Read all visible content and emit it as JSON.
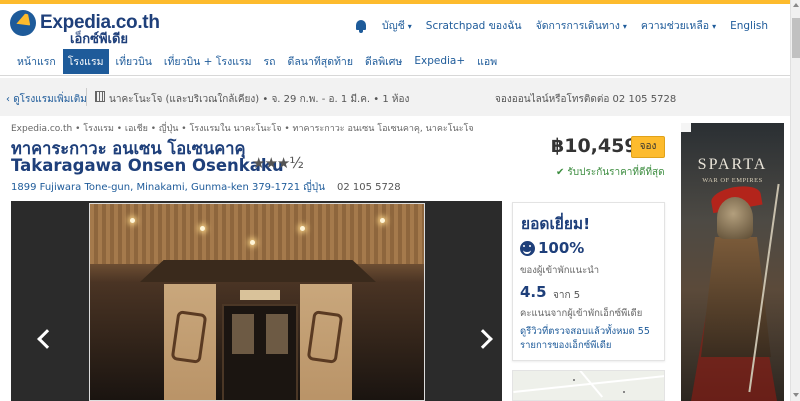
{
  "brand": {
    "name": "Expedia.co.th",
    "sub": "เอ็กซ์พีเดีย"
  },
  "top_links": {
    "account": "บัญชี",
    "scratchpad": "Scratchpad ของฉัน",
    "trips": "จัดการการเดินทาง",
    "help": "ความช่วยเหลือ",
    "language": "English"
  },
  "nav": [
    {
      "label": "หน้าแรก",
      "active": false
    },
    {
      "label": "โรงแรม",
      "active": true
    },
    {
      "label": "เที่ยวบิน",
      "active": false
    },
    {
      "label": "เที่ยวบิน + โรงแรม",
      "active": false
    },
    {
      "label": "รถ",
      "active": false
    },
    {
      "label": "ดีลนาทีสุดท้าย",
      "active": false
    },
    {
      "label": "ดีลพิเศษ",
      "active": false
    },
    {
      "label": "Expedia+",
      "active": false
    },
    {
      "label": "แอพ",
      "active": false
    }
  ],
  "subbar": {
    "back": "ดูโรงแรมเพิ่มเติม",
    "summary": "นาคะโนะโจ (และบริเวณใกล้เคียง) • จ. 29 ก.พ. - อ. 1 มี.ค. • 1 ห้อง",
    "phone": "จองออนไลน์หรือโทรติดต่อ 02 105 5728"
  },
  "hotel": {
    "breadcrumb": "Expedia.co.th • โรงแรม • เอเชีย • ญี่ปุ่น • โรงแรมใน นาคะโนะโจ • ทาคาระกาวะ อนเซน โอเซนคาคุ, นาคะโนะโจ",
    "name_th": "ทาคาระกาวะ อนเซน โอเซนคาคุ",
    "name_en": "Takaragawa Onsen Osenkaku",
    "stars": "★★★½",
    "address": "1899 Fujiwara Tone-gun, Minakami, Gunma-ken 379-1721 ญี่ปุ่น",
    "phone": "02 105 5728",
    "price": "฿10,459",
    "book_label": "จอง",
    "guarantee": "รับประกันราคาที่ดีที่สุด"
  },
  "review": {
    "title": "ยอดเยี่ยม!",
    "percent": "100%",
    "percent_label": "ของผู้เข้าพักแนะนำ",
    "score": "4.5",
    "score_of": "จาก 5",
    "score_label": "คะแนนจากผู้เข้าพักเอ็กซ์พีเดีย",
    "link": "ดูรีวิวที่ตรวจสอบแล้วทั้งหมด 55 รายการของเอ็กซ์พีเดีย"
  },
  "ad": {
    "title": "SPARTA",
    "subtitle": "WAR OF EMPIRES"
  },
  "colors": {
    "brand_blue": "#1e3f7a",
    "link_blue": "#1e5b9a",
    "accent_yellow": "#fdbb2d",
    "success_green": "#3e8e41"
  }
}
